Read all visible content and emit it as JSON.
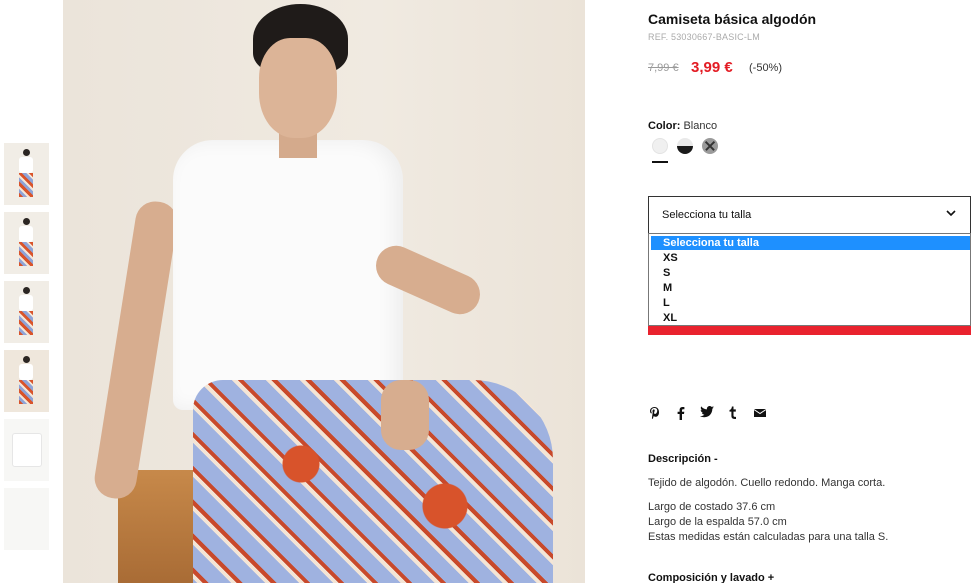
{
  "product": {
    "title": "Camiseta básica algodón",
    "ref": "REF. 53030667-BASIC-LM",
    "price_old": "7,99 €",
    "price_new": "3,99 €",
    "discount": "(-50%)"
  },
  "color": {
    "label": "Color:",
    "value": "Blanco",
    "swatches": [
      {
        "name": "Blanco",
        "hex": "#f0f0f0"
      },
      {
        "name": "Negro/Blanco",
        "hex": "#1a1a1a"
      },
      {
        "name": "Gris",
        "hex": "#9a9a9a"
      }
    ]
  },
  "size": {
    "placeholder": "Selecciona tu talla",
    "options": [
      "Selecciona tu talla",
      "XS",
      "S",
      "M",
      "L",
      "XL"
    ]
  },
  "social": {
    "icons": [
      "pinterest-icon",
      "facebook-icon",
      "twitter-icon",
      "tumblr-icon",
      "mail-icon"
    ],
    "glyphs": [
      "℗",
      "f",
      "🐦",
      "t",
      "✉"
    ]
  },
  "description": {
    "heading": "Descripción -",
    "line1": "Tejido de algodón. Cuello redondo. Manga corta.",
    "line2": "Largo de costado 37.6 cm",
    "line3": "Largo de la espalda 57.0 cm",
    "line4": "Estas medidas están calculadas para una talla S."
  },
  "composition": {
    "heading": "Composición y lavado +"
  },
  "colors": {
    "accent_red": "#e31c24",
    "highlight": "#1e90ff",
    "bar_red": "#e9222e"
  }
}
